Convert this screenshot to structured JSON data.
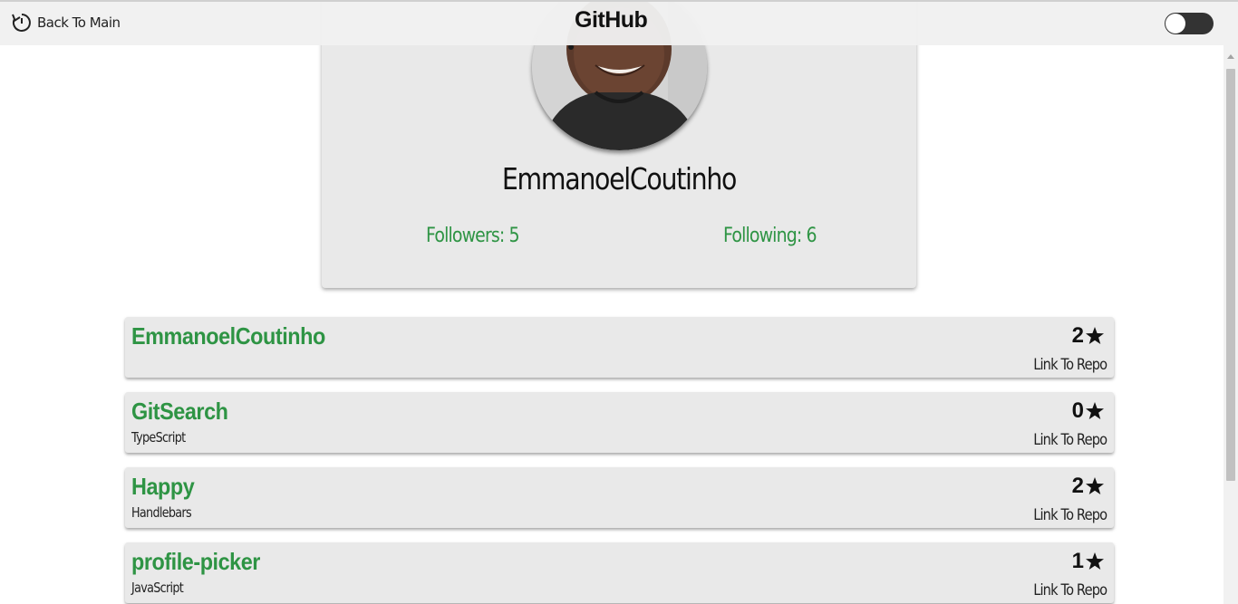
{
  "header": {
    "back_label": "Back To Main",
    "brand": "GitHub"
  },
  "profile": {
    "username": "EmmanoelCoutinho",
    "followers_label": "Followers: 5",
    "following_label": "Following: 6"
  },
  "repos": [
    {
      "name": "EmmanoelCoutinho",
      "language": "",
      "stars": "2",
      "link_label": "Link To Repo"
    },
    {
      "name": "GitSearch",
      "language": "TypeScript",
      "stars": "0",
      "link_label": "Link To Repo"
    },
    {
      "name": "Happy",
      "language": "Handlebars",
      "stars": "2",
      "link_label": "Link To Repo"
    },
    {
      "name": "profile-picker",
      "language": "JavaScript",
      "stars": "1",
      "link_label": "Link To Repo"
    }
  ],
  "colors": {
    "accent_green": "#2e9444",
    "card_bg": "#e9e9e9",
    "toggle_bg": "#333333"
  },
  "icons": {
    "back": "restart-arrow-icon",
    "star": "star-icon",
    "toggle": "theme-toggle"
  }
}
